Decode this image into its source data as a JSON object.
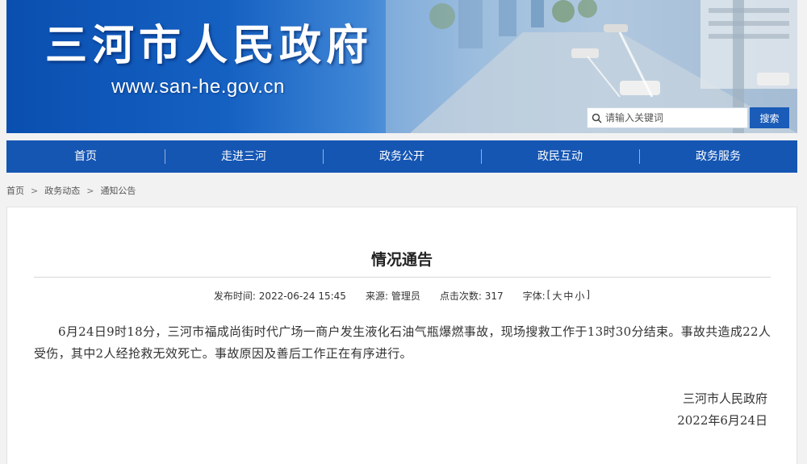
{
  "header": {
    "site_title": "三河市人民政府",
    "site_url": "www.san-he.gov.cn",
    "search": {
      "placeholder": "请输入关键词",
      "button_label": "搜索"
    },
    "accent_color": "#1556b3"
  },
  "nav": {
    "items": [
      {
        "label": "首页"
      },
      {
        "label": "走进三河"
      },
      {
        "label": "政务公开"
      },
      {
        "label": "政民互动"
      },
      {
        "label": "政务服务"
      }
    ]
  },
  "breadcrumb": {
    "items": [
      "首页",
      "政务动态",
      "通知公告"
    ],
    "separator": ">"
  },
  "article": {
    "title": "情况通告",
    "meta": {
      "publish_label": "发布时间:",
      "publish_time": "2022-06-24 15:45",
      "source_label": "来源:",
      "source": "管理员",
      "views_label": "点击次数:",
      "views": "317",
      "font_label": "字体:",
      "font_open": "[",
      "font_large": "大",
      "font_medium": "中",
      "font_small": "小",
      "font_close": "]"
    },
    "body": "6月24日9时18分，三河市福成尚街时代广场一商户发生液化石油气瓶爆燃事故，现场搜救工作于13时30分结束。事故共造成22人受伤，其中2人经抢救无效死亡。事故原因及善后工作正在有序进行。",
    "signature_org": "三河市人民政府",
    "signature_date": "2022年6月24日"
  },
  "icons": {
    "search": "search-icon"
  }
}
